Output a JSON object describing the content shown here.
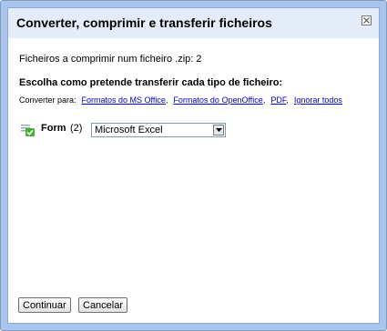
{
  "dialog": {
    "title": "Converter, comprimir e transferir ficheiros",
    "count_line": "Ficheiros a comprimir num ficheiro .zip: 2",
    "heading": "Escolha como pretende transferir cada tipo de ficheiro:",
    "convert": {
      "label": "Converter para:",
      "links": [
        {
          "label": "Formatos do MS Office",
          "sep": ","
        },
        {
          "label": "Formatos do OpenOffice",
          "sep": ","
        },
        {
          "label": "PDF",
          "sep": ","
        },
        {
          "label": "Ignorar todos",
          "sep": ""
        }
      ]
    },
    "items": [
      {
        "name": "Form",
        "count": "(2)",
        "format": "Microsoft Excel",
        "icon": "form-icon"
      }
    ],
    "buttons": {
      "continue": "Continuar",
      "cancel": "Cancelar"
    }
  },
  "colors": {
    "frame": "#a9c5ed",
    "titlebar": "#e5ecf9",
    "link": "#0000cc",
    "icon_green": "#4cae3a"
  },
  "icons": {
    "close": "close-icon",
    "dropdown": "chevron-down-icon"
  }
}
